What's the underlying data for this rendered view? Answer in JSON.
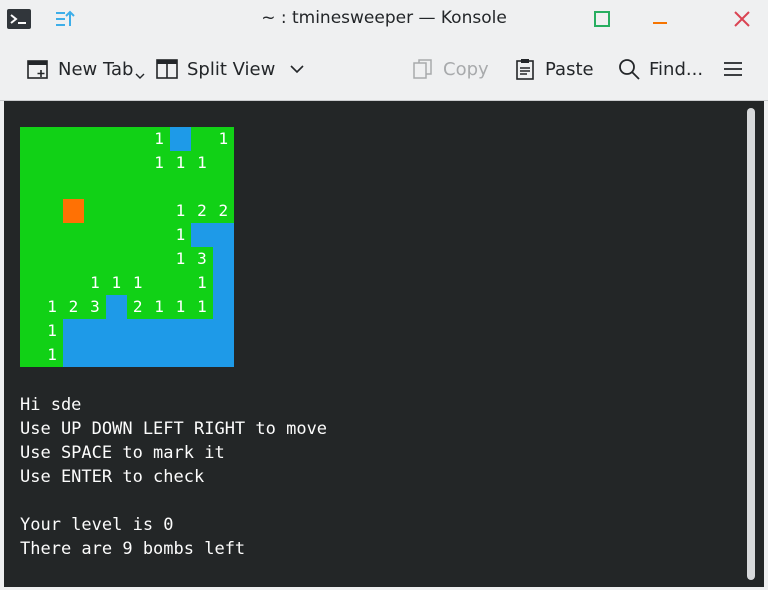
{
  "window": {
    "title": "~ : tminesweeper — Konsole"
  },
  "toolbar": {
    "new_tab": "New Tab",
    "split_view": "Split View",
    "copy": "Copy",
    "paste": "Paste",
    "find": "Find..."
  },
  "board": {
    "cols": 10,
    "rows": 10,
    "colors": {
      "covered": "#11d116",
      "revealed": "#1e9ae8",
      "cursor": "#ff7104",
      "number_text": "#ffffff"
    },
    "cells": [
      [
        " ",
        " ",
        " ",
        " ",
        " ",
        " ",
        "1",
        ".",
        " ",
        "1"
      ],
      [
        " ",
        " ",
        " ",
        " ",
        " ",
        " ",
        "1",
        "1",
        "1",
        " "
      ],
      [
        " ",
        " ",
        " ",
        " ",
        " ",
        " ",
        " ",
        " ",
        " ",
        " "
      ],
      [
        " ",
        " ",
        "@",
        " ",
        " ",
        " ",
        " ",
        "1",
        "2",
        "2"
      ],
      [
        " ",
        " ",
        " ",
        " ",
        " ",
        " ",
        " ",
        "1",
        ".",
        "."
      ],
      [
        " ",
        " ",
        " ",
        " ",
        " ",
        " ",
        " ",
        "1",
        "3",
        "."
      ],
      [
        " ",
        " ",
        " ",
        "1",
        "1",
        "1",
        " ",
        " ",
        "1",
        "."
      ],
      [
        " ",
        "1",
        "2",
        "3",
        ".",
        "2",
        "1",
        "1",
        "1",
        "."
      ],
      [
        " ",
        "1",
        ".",
        ".",
        ".",
        ".",
        ".",
        ".",
        ".",
        "."
      ],
      [
        " ",
        "1",
        ".",
        ".",
        ".",
        ".",
        ".",
        ".",
        ".",
        "."
      ]
    ]
  },
  "terminal": {
    "lines": [
      "Hi sde",
      "Use UP DOWN LEFT RIGHT to move",
      "Use SPACE to mark it",
      "Use ENTER to check",
      "",
      "Your level is 0",
      "There are 9 bombs left"
    ]
  }
}
